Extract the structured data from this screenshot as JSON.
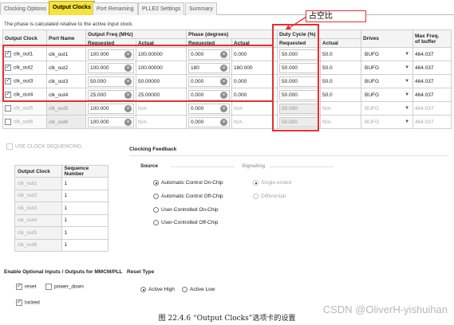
{
  "tabs": [
    "Clocking Options",
    "Output Clocks",
    "Port Renaming",
    "PLLE2 Settings",
    "Summary"
  ],
  "active_tab": "Output Clocks",
  "note": "The phase is calculated relative to the active input clock.",
  "headers": {
    "output_clock": "Output Clock",
    "port_name": "Port Name",
    "output_freq": "Output Freq (MHz)",
    "phase": "Phase (degrees)",
    "duty_cycle": "Duty Cycle (%)",
    "drives": "Drives",
    "max_freq_line1": "Max Freq.",
    "max_freq_line2": "of buffer",
    "requested": "Requested",
    "actual": "Actual"
  },
  "rows": [
    {
      "clock": "clk_out1",
      "port": "clk_out1",
      "freq_req": "100.000",
      "freq_act": "100.00000",
      "phase_req": "0.000",
      "phase_act": "0.000",
      "duty_req": "50.000",
      "duty_act": "50.0",
      "drives": "BUFG",
      "max_freq": "464.037",
      "checked": true,
      "enabled": true
    },
    {
      "clock": "clk_out2",
      "port": "clk_out2",
      "freq_req": "100.000",
      "freq_act": "100.00000",
      "phase_req": "180",
      "phase_act": "180.000",
      "duty_req": "50.000",
      "duty_act": "50.0",
      "drives": "BUFG",
      "max_freq": "464.037",
      "checked": true,
      "enabled": true
    },
    {
      "clock": "clk_out3",
      "port": "clk_out3",
      "freq_req": "50.000",
      "freq_act": "50.00000",
      "phase_req": "0.000",
      "phase_act": "0.000",
      "duty_req": "50.000",
      "duty_act": "50.0",
      "drives": "BUFG",
      "max_freq": "464.037",
      "checked": true,
      "enabled": true
    },
    {
      "clock": "clk_out4",
      "port": "clk_out4",
      "freq_req": "25.000",
      "freq_act": "25.00000",
      "phase_req": "0.000",
      "phase_act": "0.000",
      "duty_req": "50.000",
      "duty_act": "50.0",
      "drives": "BUFG",
      "max_freq": "464.037",
      "checked": true,
      "enabled": true
    },
    {
      "clock": "clk_out5",
      "port": "clk_out5",
      "freq_req": "100.000",
      "freq_act": "N/A",
      "phase_req": "0.000",
      "phase_act": "N/A",
      "duty_req": "50.000",
      "duty_act": "N/A",
      "drives": "BUFG",
      "max_freq": "464.037",
      "checked": false,
      "enabled": false
    },
    {
      "clock": "clk_out6",
      "port": "clk_out6",
      "freq_req": "100.000",
      "freq_act": "N/A",
      "phase_req": "0.000",
      "phase_act": "N/A",
      "duty_req": "50.000",
      "duty_act": "N/A",
      "drives": "BUFG",
      "max_freq": "464.037",
      "checked": false,
      "enabled": false
    }
  ],
  "annotation": "占空比",
  "use_clock_sequencing": "USE CLOCK SEQUENCING",
  "sequence_table": {
    "headers": [
      "Output Clock",
      "Sequence Number"
    ],
    "rows": [
      [
        "clk_out1",
        "1"
      ],
      [
        "clk_out2",
        "1"
      ],
      [
        "clk_out3",
        "1"
      ],
      [
        "clk_out4",
        "1"
      ],
      [
        "clk_out5",
        "1"
      ],
      [
        "clk_out6",
        "1"
      ]
    ]
  },
  "clocking_feedback": {
    "title": "Clocking Feedback",
    "source_title": "Source",
    "signaling_title": "Signaling",
    "source_options": [
      "Automatic Control On-Chip",
      "Automatic Control Off-Chip",
      "User-Controlled On-Chip",
      "User-Controlled Off-Chip"
    ],
    "signaling_options": [
      "Single-ended",
      "Differential"
    ]
  },
  "optional_io": {
    "title": "Enable Optional Inputs / Outputs for MMCM/PLL",
    "reset": "reset",
    "power_down": "power_down",
    "locked": "locked"
  },
  "reset_type": {
    "title": "Reset Type",
    "options": [
      "Active High",
      "Active Low"
    ]
  },
  "caption": "图  22.4.6  “Output Clocks”选项卡的设置",
  "watermark": "CSDN @OliverH-yishuihan",
  "colors": {
    "active_tab": "#f5e23a",
    "annotation_red": "#e53030"
  }
}
